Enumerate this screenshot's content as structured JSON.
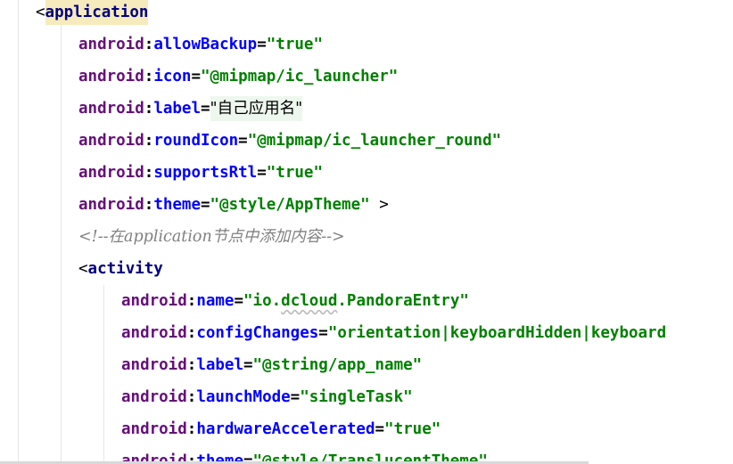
{
  "editor": {
    "lines": [
      {
        "open": "<",
        "tag": "application"
      },
      {
        "ns": "android",
        "attr": "allowBackup",
        "value": "\"true\""
      },
      {
        "ns": "android",
        "attr": "icon",
        "value": "\"@mipmap/ic_launcher\""
      },
      {
        "ns": "android",
        "attr": "label",
        "value": "\"自己应用名\""
      },
      {
        "ns": "android",
        "attr": "roundIcon",
        "value": "\"@mipmap/ic_launcher_round\""
      },
      {
        "ns": "android",
        "attr": "supportsRtl",
        "value": "\"true\""
      },
      {
        "ns": "android",
        "attr": "theme",
        "value": "\"@style/AppTheme\"",
        "close": " >"
      },
      {
        "comment": "<!--在application节点中添加内容-->"
      },
      {
        "open": "<",
        "tag": "activity"
      },
      {
        "ns": "android",
        "attr": "name",
        "value_pre": "\"io.",
        "value_squiggle": "dcloud",
        "value_post": ".PandoraEntry\""
      },
      {
        "ns": "android",
        "attr": "configChanges",
        "value": "\"orientation|keyboardHidden|keyboard"
      },
      {
        "ns": "android",
        "attr": "label",
        "value": "\"@string/app_name\""
      },
      {
        "ns": "android",
        "attr": "launchMode",
        "value": "\"singleTask\""
      },
      {
        "ns": "android",
        "attr": "hardwareAccelerated",
        "value": "\"true\""
      },
      {
        "ns": "android",
        "attr": "theme",
        "value": "\"@style/TranslucentTheme\""
      }
    ]
  }
}
